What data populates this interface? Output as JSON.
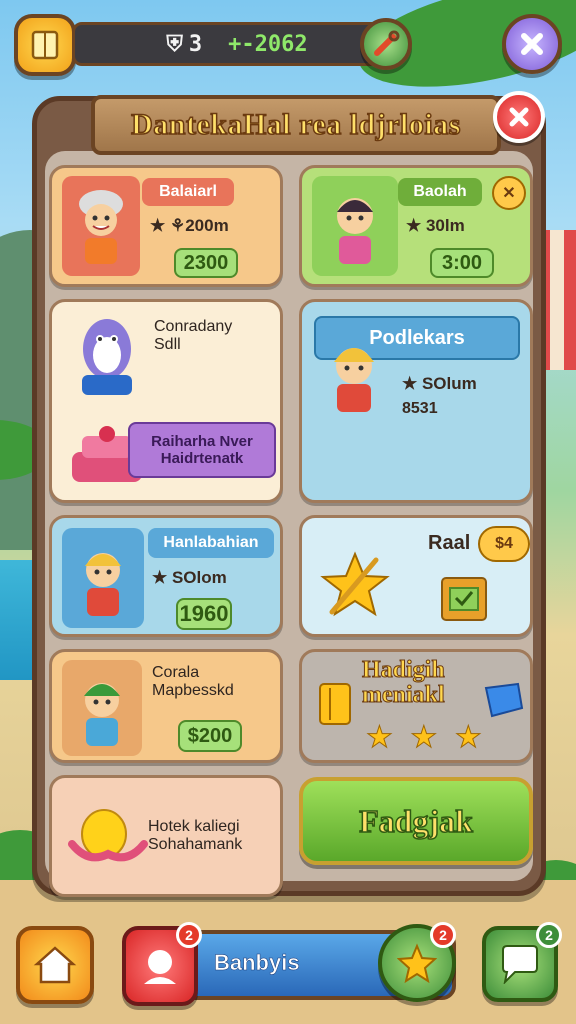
{
  "top_bar": {
    "gems": "3",
    "cash": "+-2062"
  },
  "panel": {
    "title": "DantekaHal rea ldjrloias"
  },
  "cards": {
    "c1": {
      "name": "Balaiarl",
      "rate": "★ ⚘200m",
      "price": "2300"
    },
    "c2": {
      "name": "Baolah",
      "rate": "★ 30lm",
      "price": "3:00"
    },
    "c3": {
      "desc_line1": "Conradany",
      "desc_line2": "Sdll",
      "tag_line1": "Raiharha Nver",
      "tag_line2": "Haidrtenatk"
    },
    "c4": {
      "name": "Podlekars",
      "rate": "★ SOlum",
      "sub": "8531"
    },
    "c5": {
      "name": "Hanlabahian",
      "rate": "★ SOlom",
      "price": "1960"
    },
    "c6": {
      "name": "Raal",
      "badge": "$4"
    },
    "c7": {
      "desc_line1": "Corala",
      "desc_line2": "Mapbesskd",
      "price": "$200"
    },
    "c8": {
      "line1": "Hadigih",
      "line2": "meniakl",
      "stars": "★ ★ ★"
    },
    "c9": {
      "line1": "Hotek kaliegi",
      "line2": "Sohahamank"
    },
    "c10": {
      "button": "Fadgjak"
    }
  },
  "bottom_bar": {
    "center_label": "Banbyis",
    "profile_badge": "2",
    "star_badge": "2",
    "chat_badge": "2"
  },
  "colors": {
    "panel": "#7a5a45",
    "title": "#ffe06a",
    "green_button": "#7fcf3f",
    "blue_card": "#a8d8ea",
    "orange_card": "#f6c88a"
  }
}
